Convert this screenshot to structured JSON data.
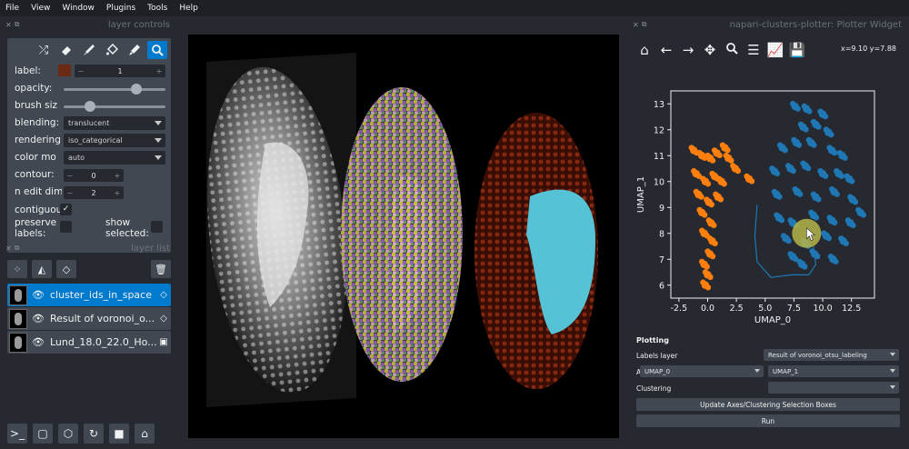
{
  "menu": [
    "File",
    "View",
    "Window",
    "Plugins",
    "Tools",
    "Help"
  ],
  "layer_controls": {
    "title": "layer controls",
    "label_label": "label:",
    "label_value": "1",
    "label_color": "#6b2a13",
    "opacity_label": "opacity:",
    "opacity_value": 0.7,
    "brush_label": "brush siz",
    "brush_value": 0.2,
    "blending_label": "blending:",
    "blending_value": "translucent",
    "rendering_label": "rendering",
    "rendering_value": "iso_categorical",
    "colormode_label": "color mo",
    "colormode_value": "auto",
    "contour_label": "contour:",
    "contour_value": "0",
    "ndim_label": "n edit dim",
    "ndim_value": "2",
    "contiguous_label": "contiguou",
    "preserve_label": "preserve labels:",
    "show_selected_label": "show selected:",
    "tools": [
      "shuffle-icon",
      "eraser-icon",
      "paint-brush-icon",
      "fill-bucket-icon",
      "color-picker-icon",
      "zoom-icon"
    ]
  },
  "layer_list": {
    "title": "layer list",
    "layers": [
      {
        "name": "cluster_ids_in_space",
        "type_icon": "labels-icon",
        "selected": true
      },
      {
        "name": "Result of voronoi_o...",
        "type_icon": "labels-icon",
        "selected": false
      },
      {
        "name": "Lund_18.0_22.0_Ho...",
        "type_icon": "image-icon",
        "selected": false
      }
    ]
  },
  "plotter": {
    "title": "napari-clusters-plotter: Plotter Widget",
    "coords": "x=9.10 y=7.88",
    "section": "Plotting",
    "labels_layer_label": "Labels layer",
    "labels_layer_value": "Result of voronoi_otsu_labeling",
    "axes_label": "Axes",
    "axes_x": "UMAP_0",
    "axes_y": "UMAP_1",
    "clustering_label": "Clustering",
    "clustering_value": "",
    "update_button": "Update Axes/Clustering Selection Boxes",
    "run_button": "Run"
  },
  "chart_data": {
    "type": "scatter",
    "xlabel": "UMAP_0",
    "ylabel": "UMAP_1",
    "xlim": [
      -3.2,
      14.5
    ],
    "ylim": [
      5.5,
      13.5
    ],
    "xticks": [
      "-2.5",
      "0.0",
      "2.5",
      "5.0",
      "7.5",
      "10.0",
      "12.5"
    ],
    "xtick_values": [
      -2.5,
      0.0,
      2.5,
      5.0,
      7.5,
      10.0,
      12.5
    ],
    "yticks": [
      "6",
      "7",
      "8",
      "9",
      "10",
      "11",
      "12",
      "13"
    ],
    "ytick_values": [
      6,
      7,
      8,
      9,
      10,
      11,
      12,
      13
    ],
    "series": [
      {
        "color": "#ff7f0e",
        "values": [
          [
            -1.2,
            11.2
          ],
          [
            -0.5,
            11.0
          ],
          [
            0.2,
            10.9
          ],
          [
            0.8,
            11.1
          ],
          [
            1.5,
            11.3
          ],
          [
            1.8,
            10.9
          ],
          [
            2.4,
            10.5
          ],
          [
            3.6,
            10.1
          ],
          [
            -1.0,
            10.3
          ],
          [
            -0.2,
            10.0
          ],
          [
            0.6,
            10.2
          ],
          [
            1.2,
            10.0
          ],
          [
            -0.8,
            9.5
          ],
          [
            0.1,
            9.2
          ],
          [
            0.9,
            9.4
          ],
          [
            -0.5,
            8.8
          ],
          [
            0.3,
            8.4
          ],
          [
            -0.3,
            8.0
          ],
          [
            0.4,
            7.7
          ],
          [
            0.2,
            7.2
          ],
          [
            -0.3,
            6.8
          ],
          [
            0.0,
            6.4
          ],
          [
            -0.2,
            6.0
          ]
        ]
      },
      {
        "color": "#1f77b4",
        "values": [
          [
            7.6,
            12.9
          ],
          [
            8.6,
            12.8
          ],
          [
            10.0,
            12.6
          ],
          [
            8.3,
            12.1
          ],
          [
            9.4,
            12.2
          ],
          [
            10.5,
            11.9
          ],
          [
            6.5,
            11.3
          ],
          [
            7.7,
            11.5
          ],
          [
            9.0,
            11.5
          ],
          [
            10.8,
            11.2
          ],
          [
            11.7,
            11.0
          ],
          [
            5.8,
            10.4
          ],
          [
            7.2,
            10.5
          ],
          [
            8.5,
            10.6
          ],
          [
            10.0,
            10.3
          ],
          [
            11.4,
            10.3
          ],
          [
            12.3,
            10.1
          ],
          [
            6.0,
            9.5
          ],
          [
            7.8,
            9.6
          ],
          [
            9.4,
            9.4
          ],
          [
            11.0,
            9.6
          ],
          [
            12.6,
            9.3
          ],
          [
            6.2,
            8.6
          ],
          [
            7.4,
            8.4
          ],
          [
            9.2,
            8.7
          ],
          [
            10.8,
            8.5
          ],
          [
            12.4,
            8.4
          ],
          [
            13.3,
            8.8
          ],
          [
            6.8,
            7.8
          ],
          [
            8.5,
            7.6
          ],
          [
            10.3,
            7.9
          ],
          [
            11.8,
            7.7
          ],
          [
            7.4,
            7.1
          ],
          [
            9.3,
            7.2
          ],
          [
            10.9,
            7.0
          ],
          [
            8.2,
            6.8
          ]
        ]
      }
    ],
    "selection_path": [
      [
        4.3,
        9.1
      ],
      [
        4.1,
        7.9
      ],
      [
        4.3,
        6.9
      ],
      [
        5.5,
        6.3
      ],
      [
        7.3,
        6.4
      ],
      [
        8.8,
        6.4
      ],
      [
        9.4,
        6.8
      ],
      [
        9.2,
        7.5
      ]
    ],
    "cursor_highlight": [
      8.6,
      8.0
    ]
  },
  "bottom_tools": [
    "console-icon",
    "square-icon",
    "cube-icon",
    "rotate-icon",
    "grid-icon",
    "home-icon"
  ]
}
